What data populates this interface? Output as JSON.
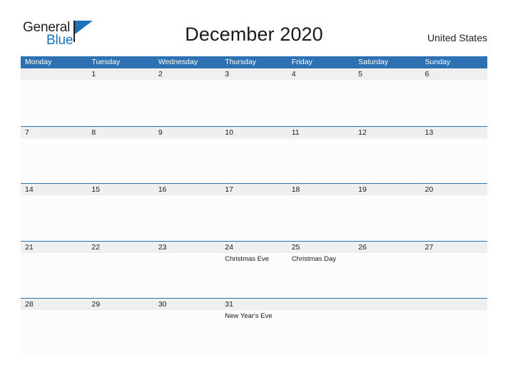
{
  "brand": {
    "name_part1": "General",
    "name_part2": "Blue",
    "flag_icon": "flag-triangle-icon",
    "accent_color": "#1b72b8"
  },
  "header": {
    "title": "December 2020",
    "country": "United States"
  },
  "calendar": {
    "header_bg": "#2e71b2",
    "date_band_bg": "#efefef",
    "weekdays": [
      "Monday",
      "Tuesday",
      "Wednesday",
      "Thursday",
      "Friday",
      "Saturday",
      "Sunday"
    ],
    "weeks": [
      [
        {
          "date": "",
          "holiday": ""
        },
        {
          "date": "1",
          "holiday": ""
        },
        {
          "date": "2",
          "holiday": ""
        },
        {
          "date": "3",
          "holiday": ""
        },
        {
          "date": "4",
          "holiday": ""
        },
        {
          "date": "5",
          "holiday": ""
        },
        {
          "date": "6",
          "holiday": ""
        }
      ],
      [
        {
          "date": "7",
          "holiday": ""
        },
        {
          "date": "8",
          "holiday": ""
        },
        {
          "date": "9",
          "holiday": ""
        },
        {
          "date": "10",
          "holiday": ""
        },
        {
          "date": "11",
          "holiday": ""
        },
        {
          "date": "12",
          "holiday": ""
        },
        {
          "date": "13",
          "holiday": ""
        }
      ],
      [
        {
          "date": "14",
          "holiday": ""
        },
        {
          "date": "15",
          "holiday": ""
        },
        {
          "date": "16",
          "holiday": ""
        },
        {
          "date": "17",
          "holiday": ""
        },
        {
          "date": "18",
          "holiday": ""
        },
        {
          "date": "19",
          "holiday": ""
        },
        {
          "date": "20",
          "holiday": ""
        }
      ],
      [
        {
          "date": "21",
          "holiday": ""
        },
        {
          "date": "22",
          "holiday": ""
        },
        {
          "date": "23",
          "holiday": ""
        },
        {
          "date": "24",
          "holiday": "Christmas Eve"
        },
        {
          "date": "25",
          "holiday": "Christmas Day"
        },
        {
          "date": "26",
          "holiday": ""
        },
        {
          "date": "27",
          "holiday": ""
        }
      ],
      [
        {
          "date": "28",
          "holiday": ""
        },
        {
          "date": "29",
          "holiday": ""
        },
        {
          "date": "30",
          "holiday": ""
        },
        {
          "date": "31",
          "holiday": "New Year's Eve"
        },
        {
          "date": "",
          "holiday": ""
        },
        {
          "date": "",
          "holiday": ""
        },
        {
          "date": "",
          "holiday": ""
        }
      ]
    ]
  }
}
